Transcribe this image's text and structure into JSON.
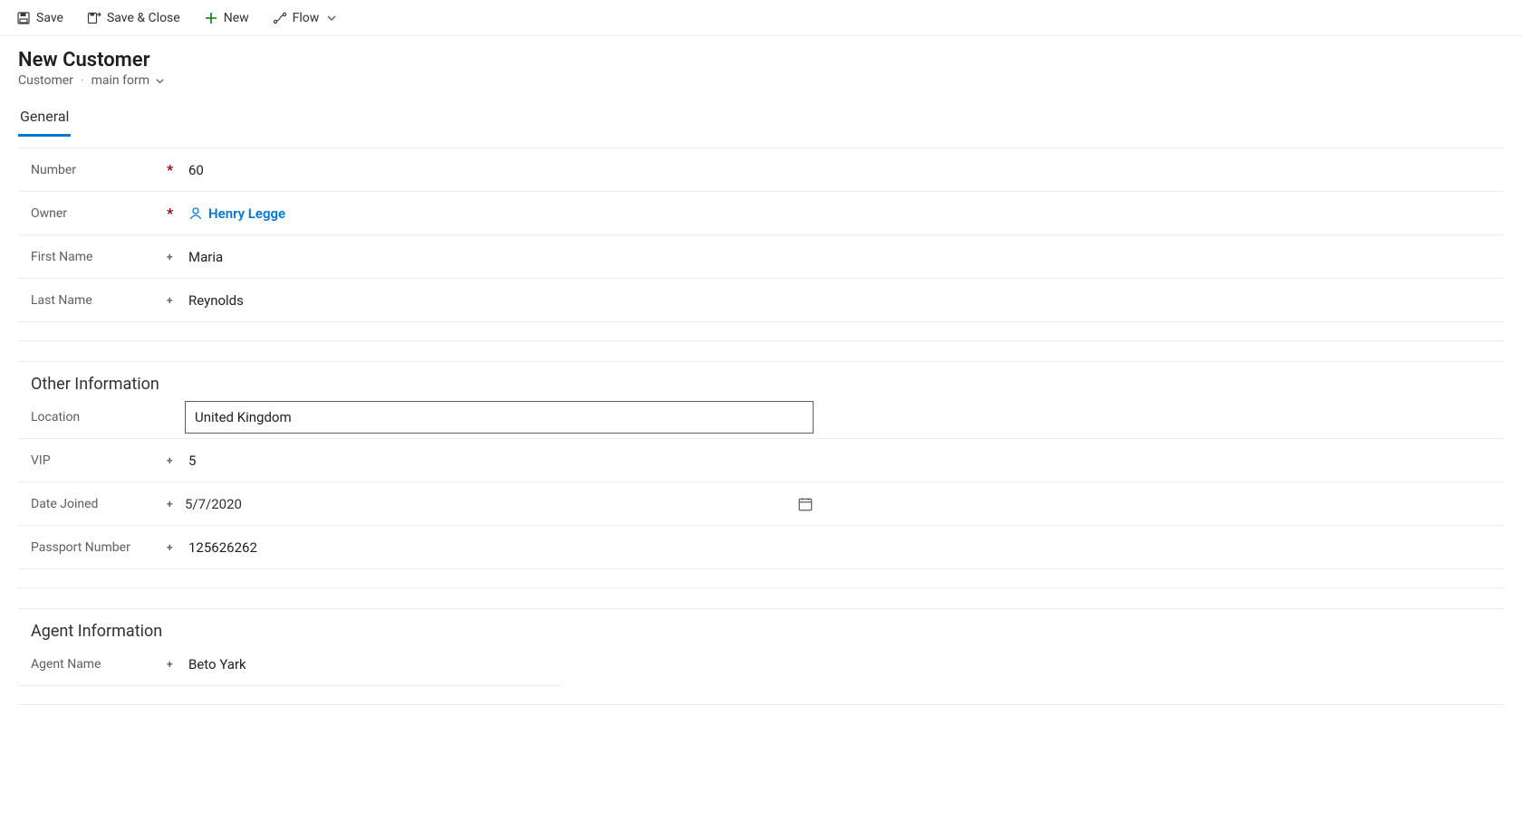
{
  "commandBar": {
    "save": "Save",
    "saveClose": "Save & Close",
    "new": "New",
    "flow": "Flow"
  },
  "header": {
    "title": "New Customer",
    "entity": "Customer",
    "formName": "main form"
  },
  "tabs": {
    "general": "General"
  },
  "fields": {
    "number": {
      "label": "Number",
      "value": "60"
    },
    "owner": {
      "label": "Owner",
      "value": "Henry Legge"
    },
    "firstName": {
      "label": "First Name",
      "value": "Maria"
    },
    "lastName": {
      "label": "Last Name",
      "value": "Reynolds"
    }
  },
  "otherInfo": {
    "title": "Other Information",
    "location": {
      "label": "Location",
      "value": "United Kingdom"
    },
    "vip": {
      "label": "VIP",
      "value": "5"
    },
    "dateJoined": {
      "label": "Date Joined",
      "value": "5/7/2020"
    },
    "passport": {
      "label": "Passport Number",
      "value": "125626262"
    }
  },
  "agentInfo": {
    "title": "Agent Information",
    "agentName": {
      "label": "Agent Name",
      "value": "Beto Yark"
    }
  },
  "markers": {
    "required": "*",
    "optional": "+"
  }
}
